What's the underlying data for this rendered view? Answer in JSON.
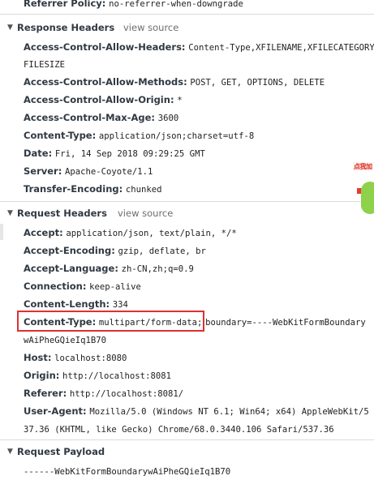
{
  "top": {
    "name": "Referrer Policy:",
    "value": "no-referrer-when-downgrade"
  },
  "response": {
    "title": "Response Headers",
    "view_source": "view source",
    "headers": [
      {
        "name": "Access-Control-Allow-Headers:",
        "value": "Content-Type,XFILENAME,XFILECATEGORY,X",
        "cont": "FILESIZE"
      },
      {
        "name": "Access-Control-Allow-Methods:",
        "value": "POST, GET, OPTIONS, DELETE"
      },
      {
        "name": "Access-Control-Allow-Origin:",
        "value": "*"
      },
      {
        "name": "Access-Control-Max-Age:",
        "value": "3600"
      },
      {
        "name": "Content-Type:",
        "value": "application/json;charset=utf-8"
      },
      {
        "name": "Date:",
        "value": "Fri, 14 Sep 2018 09:29:25 GMT"
      },
      {
        "name": "Server:",
        "value": "Apache-Coyote/1.1"
      },
      {
        "name": "Transfer-Encoding:",
        "value": "chunked"
      }
    ]
  },
  "request": {
    "title": "Request Headers",
    "view_source": "view source",
    "headers": [
      {
        "name": "Accept:",
        "value": "application/json, text/plain, */*"
      },
      {
        "name": "Accept-Encoding:",
        "value": "gzip, deflate, br"
      },
      {
        "name": "Accept-Language:",
        "value": "zh-CN,zh;q=0.9"
      },
      {
        "name": "Connection:",
        "value": "keep-alive"
      },
      {
        "name": "Content-Length:",
        "value": "334"
      },
      {
        "name": "Content-Type:",
        "value": "multipart/form-data;",
        "value2": "boundary=----WebKitFormBoundary",
        "cont": "wAiPheGQieIq1B70"
      },
      {
        "name": "Host:",
        "value": "localhost:8080"
      },
      {
        "name": "Origin:",
        "value": "http://localhost:8081"
      },
      {
        "name": "Referer:",
        "value": "http://localhost:8081/"
      },
      {
        "name": "User-Agent:",
        "value": "Mozilla/5.0 (Windows NT 6.1; Win64; x64) AppleWebKit/5",
        "cont": "37.36 (KHTML, like Gecko) Chrome/68.0.3440.106 Safari/537.36"
      }
    ]
  },
  "payload": {
    "title": "Request Payload",
    "first_line": "------WebKitFormBoundarywAiPheGQieIq1B70"
  },
  "overlay": {
    "badge_text": "点我加",
    "icon": "mascot-icon"
  },
  "colors": {
    "highlight": "#e0302f",
    "text": "#303942",
    "muted": "#6d6d6d"
  }
}
